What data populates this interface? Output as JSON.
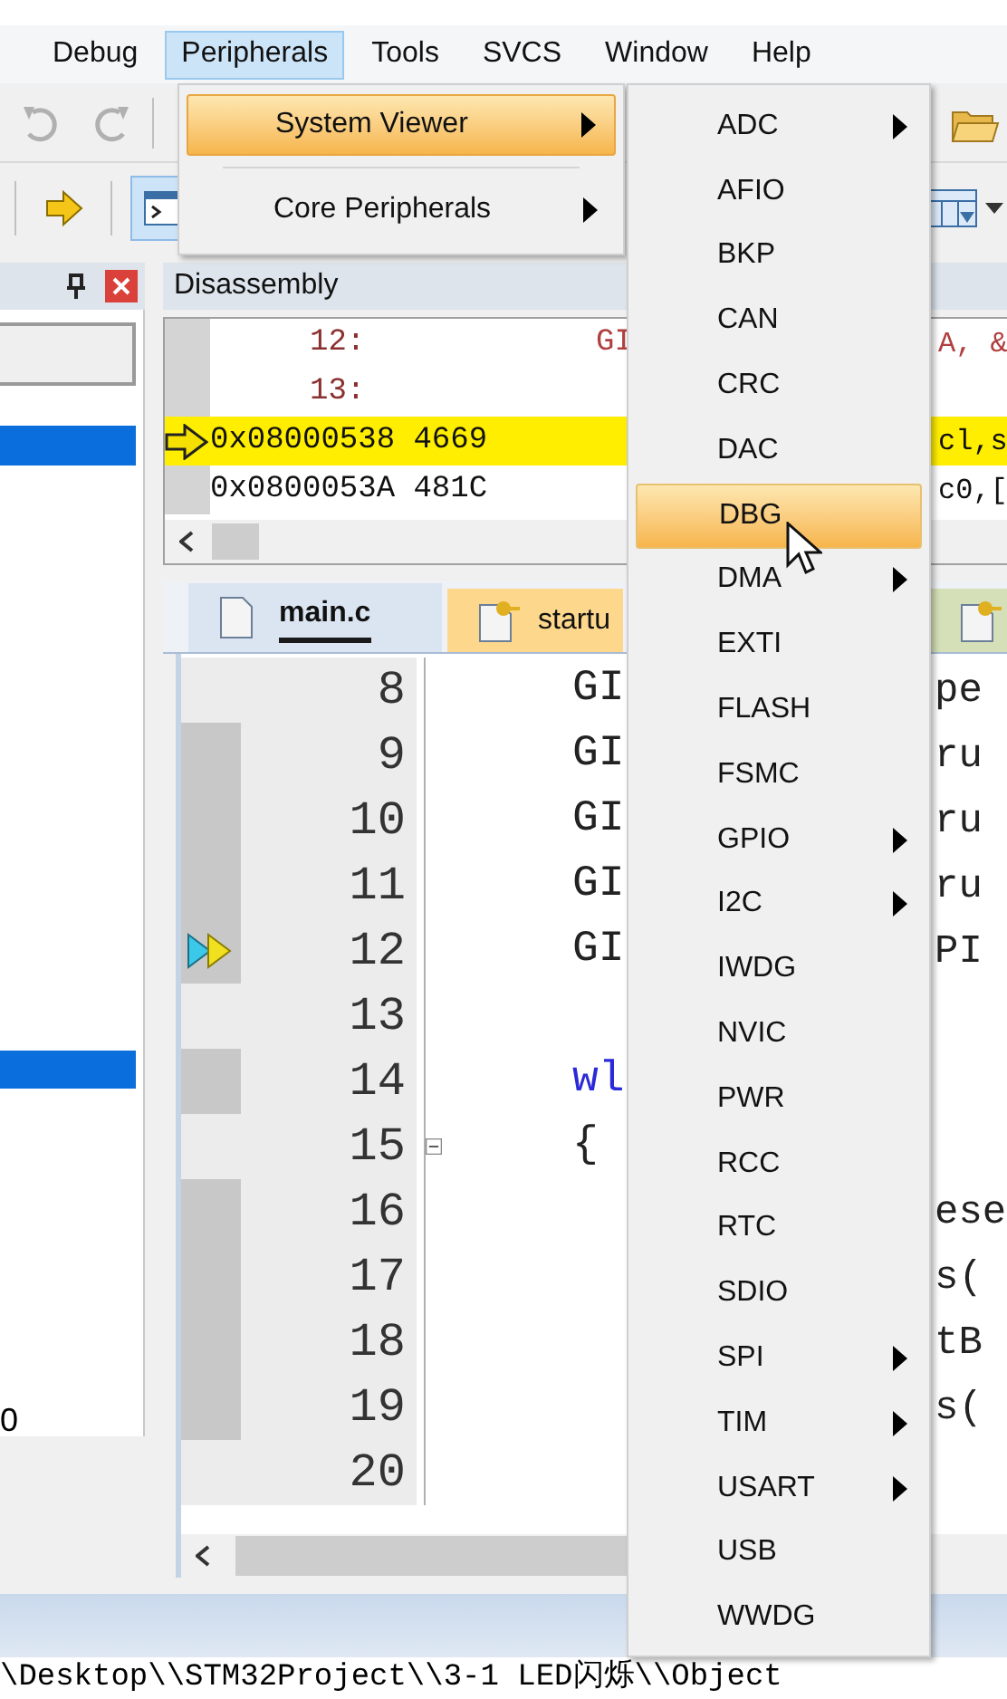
{
  "menu_bar": [
    {
      "label": "Debug",
      "selected": false
    },
    {
      "label": "Peripherals",
      "selected": true
    },
    {
      "label": "Tools",
      "selected": false
    },
    {
      "label": "SVCS",
      "selected": false
    },
    {
      "label": "Window",
      "selected": false
    },
    {
      "label": "Help",
      "selected": false
    }
  ],
  "peripherals_menu": [
    {
      "label": "System Viewer",
      "selected": true,
      "submenu": true
    },
    {
      "label": "Core Peripherals",
      "selected": false,
      "submenu": true
    }
  ],
  "system_viewer_menu": [
    {
      "label": "ADC",
      "selected": false,
      "submenu": true
    },
    {
      "label": "AFIO",
      "selected": false,
      "submenu": false
    },
    {
      "label": "BKP",
      "selected": false,
      "submenu": false
    },
    {
      "label": "CAN",
      "selected": false,
      "submenu": false
    },
    {
      "label": "CRC",
      "selected": false,
      "submenu": false
    },
    {
      "label": "DAC",
      "selected": false,
      "submenu": false
    },
    {
      "label": "DBG",
      "selected": true,
      "submenu": false
    },
    {
      "label": "DMA",
      "selected": false,
      "submenu": true
    },
    {
      "label": "EXTI",
      "selected": false,
      "submenu": false
    },
    {
      "label": "FLASH",
      "selected": false,
      "submenu": false
    },
    {
      "label": "FSMC",
      "selected": false,
      "submenu": false
    },
    {
      "label": "GPIO",
      "selected": false,
      "submenu": true
    },
    {
      "label": "I2C",
      "selected": false,
      "submenu": true
    },
    {
      "label": "IWDG",
      "selected": false,
      "submenu": false
    },
    {
      "label": "NVIC",
      "selected": false,
      "submenu": false
    },
    {
      "label": "PWR",
      "selected": false,
      "submenu": false
    },
    {
      "label": "RCC",
      "selected": false,
      "submenu": false
    },
    {
      "label": "RTC",
      "selected": false,
      "submenu": false
    },
    {
      "label": "SDIO",
      "selected": false,
      "submenu": false
    },
    {
      "label": "SPI",
      "selected": false,
      "submenu": true
    },
    {
      "label": "TIM",
      "selected": false,
      "submenu": true
    },
    {
      "label": "USART",
      "selected": false,
      "submenu": true
    },
    {
      "label": "USB",
      "selected": false,
      "submenu": false
    },
    {
      "label": "WWDG",
      "selected": false,
      "submenu": false
    }
  ],
  "left_panel": {
    "rows": [
      {
        "selected": true
      },
      {
        "selected": true
      },
      {
        "selected": false,
        "text": "0"
      }
    ]
  },
  "disassembly": {
    "title": "Disassembly",
    "lines": [
      {
        "kind": "source",
        "left": "12:",
        "mid": "GI",
        "right": "A, &"
      },
      {
        "kind": "source",
        "left": "13:"
      },
      {
        "kind": "instruction",
        "current": true,
        "left": "0x08000538 4669",
        "right": "cl,s"
      },
      {
        "kind": "instruction",
        "current": false,
        "left": "0x0800053A 481C",
        "right": "c0,["
      }
    ]
  },
  "editor": {
    "tabs": [
      {
        "label": "main.c",
        "selected": true,
        "kind": "source"
      },
      {
        "label": "startu",
        "selected": false,
        "kind": "startup"
      },
      {
        "selected": false,
        "kind": "other"
      }
    ],
    "lines": [
      {
        "number": "8",
        "executed": false,
        "code": "GI",
        "tail": "pe"
      },
      {
        "number": "9",
        "executed": true,
        "code": "GI",
        "tail": "ru"
      },
      {
        "number": "10",
        "executed": true,
        "code": "GI",
        "tail": "ru"
      },
      {
        "number": "11",
        "executed": true,
        "code": "GI",
        "tail": "ru"
      },
      {
        "number": "12",
        "executed": true,
        "current": true,
        "code": "GI",
        "tail": "PI"
      },
      {
        "number": "13",
        "executed": false
      },
      {
        "number": "14",
        "executed": true,
        "code": "wl",
        "keyword": true
      },
      {
        "number": "15",
        "executed": false,
        "fold": true,
        "code": "{"
      },
      {
        "number": "16",
        "executed": true,
        "tail": "ese"
      },
      {
        "number": "17",
        "executed": true,
        "tail": "s("
      },
      {
        "number": "18",
        "executed": true,
        "tail": "tB"
      },
      {
        "number": "19",
        "executed": true,
        "tail": "s("
      },
      {
        "number": "20",
        "executed": false
      }
    ]
  },
  "status_path": "\\Desktop\\\\STM32Project\\\\3-1 LED闪烁\\\\Object"
}
